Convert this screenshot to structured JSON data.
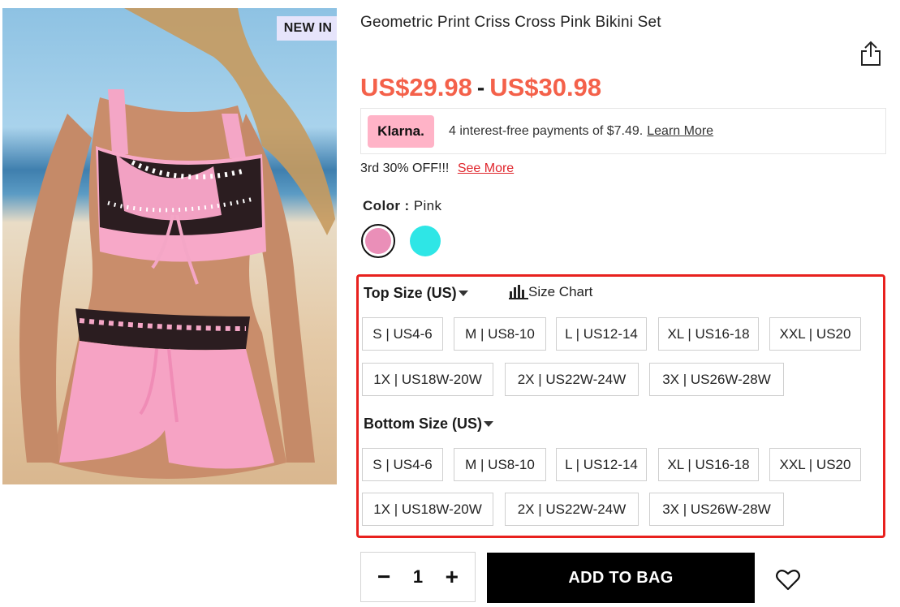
{
  "product": {
    "badge": "NEW IN",
    "title": "Geometric Print Criss Cross Pink Bikini Set",
    "price_low": "US$29.98",
    "price_separator": "-",
    "price_high": "US$30.98"
  },
  "icons": {
    "share": "share-icon",
    "size_chart": "bar-chart-icon",
    "wishlist": "heart-icon",
    "caret": "caret-down-icon"
  },
  "klarna": {
    "logo_text": "Klarna.",
    "text": "4 interest-free payments of $7.49.",
    "link": "Learn More"
  },
  "promo": {
    "text": "3rd 30% OFF!!!",
    "link": "See More"
  },
  "color": {
    "label": "Color :",
    "value": "Pink",
    "swatches": [
      {
        "name": "Pink",
        "hex": "#ea8fb8",
        "selected": true
      },
      {
        "name": "Cyan",
        "hex": "#2ee6e6",
        "selected": false
      }
    ]
  },
  "top_size": {
    "label": "Top Size (US)",
    "chart_link": "Size Chart",
    "options": [
      "S | US4-6",
      "M | US8-10",
      "L | US12-14",
      "XL | US16-18",
      "XXL | US20",
      "1X | US18W-20W",
      "2X | US22W-24W",
      "3X | US26W-28W"
    ]
  },
  "bottom_size": {
    "label": "Bottom Size (US)",
    "options": [
      "S | US4-6",
      "M | US8-10",
      "L | US12-14",
      "XL | US16-18",
      "XXL | US20",
      "1X | US18W-20W",
      "2X | US22W-24W",
      "3X | US26W-28W"
    ]
  },
  "cart": {
    "minus": "−",
    "quantity": "1",
    "plus": "+",
    "add_to_bag": "ADD TO BAG"
  },
  "colors": {
    "price": "#f4614a",
    "highlight_border": "#e8211e",
    "klarna_pink": "#ffb3c7",
    "promo_link": "#e0262d"
  }
}
